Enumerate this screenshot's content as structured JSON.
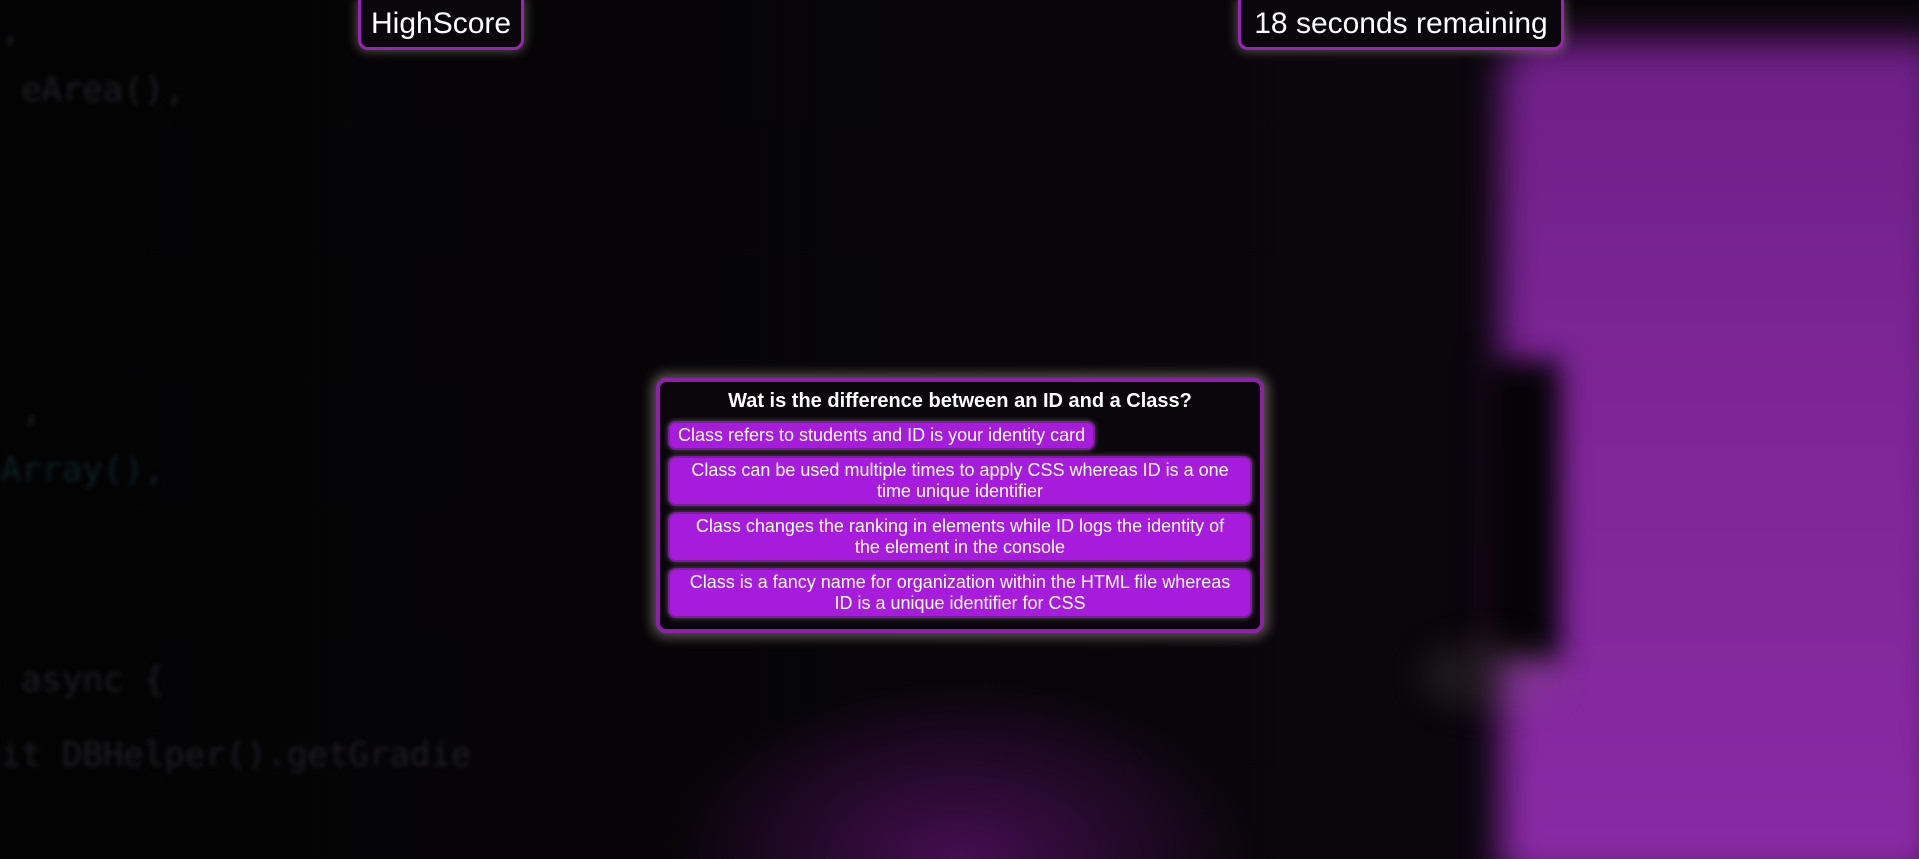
{
  "header": {
    "highscore_label": "HighScore",
    "timer_text": "18 seconds remaining"
  },
  "quiz": {
    "question": "Wat is the difference between an ID and a Class?",
    "answers": [
      "Class refers to students and ID is your identity card",
      "Class can be used multiple times to apply CSS whereas ID is a one time unique identifier",
      "Class changes the ranking in elements while ID logs the identity of the element in the console",
      "Class is a fancy name for organization within the HTML file whereas ID is a unique identifier for CSS"
    ]
  },
  "background": {
    "code_lines": [
      "a,",
      "  eArea(),",
      "  ,",
      "eArray(),",
      "n async {",
      "ait DBHelper().getGradie",
      "  }"
    ]
  },
  "colors": {
    "accent": "#a71bdc",
    "border": "#9b21b8",
    "background": "#050306"
  }
}
